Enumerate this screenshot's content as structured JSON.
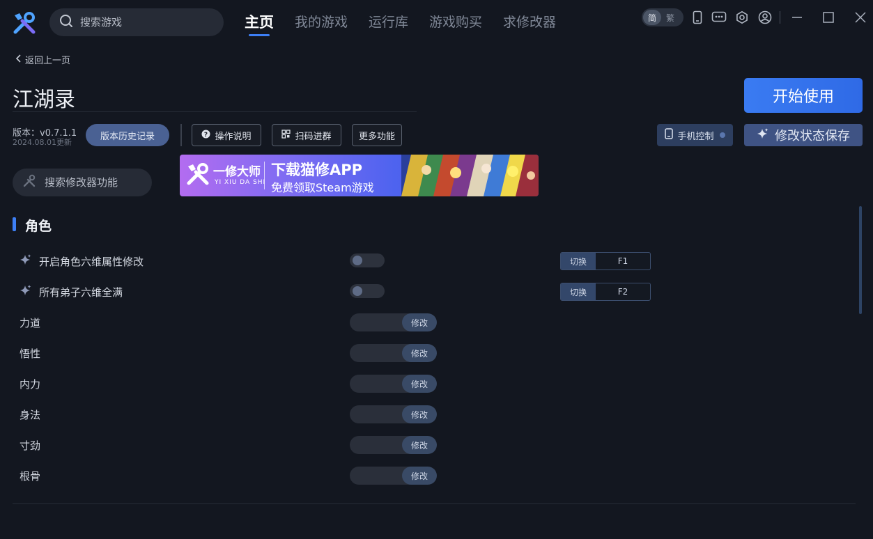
{
  "header": {
    "search_placeholder": "搜索游戏",
    "nav": [
      {
        "label": "主页",
        "active": true
      },
      {
        "label": "我的游戏",
        "active": false
      },
      {
        "label": "运行库",
        "active": false
      },
      {
        "label": "游戏购买",
        "active": false
      },
      {
        "label": "求修改器",
        "active": false
      }
    ],
    "lang": {
      "simplified": "简",
      "traditional": "繁",
      "selected": "简"
    },
    "icons": [
      "phone-icon",
      "message-icon",
      "settings-icon",
      "user-icon",
      "minimize-icon",
      "maximize-icon",
      "close-icon"
    ]
  },
  "back_label": "返回上一页",
  "game": {
    "title": "江湖录",
    "version": "版本：v0.7.1.1",
    "updated": "2024.08.01更新"
  },
  "buttons": {
    "start": "开始使用",
    "history": "版本历史记录",
    "guide": "操作说明",
    "qr": "扫码进群",
    "more": "更多功能",
    "phone": "手机控制",
    "save_state": "修改状态保存"
  },
  "mod_search_placeholder": "搜索修改器功能",
  "banner": {
    "brand": "一修大师",
    "brand_sub": "YI XIU DA SHI",
    "headline": "下载猫修APP",
    "subline": "免费领取Steam游戏"
  },
  "section": {
    "title": "角色",
    "toggles": [
      {
        "label": "开启角色六维属性修改",
        "hotkey_label": "切换",
        "hotkey": "F1",
        "on": false
      },
      {
        "label": "所有弟子六维全满",
        "hotkey_label": "切换",
        "hotkey": "F2",
        "on": false
      }
    ],
    "edits": [
      {
        "label": "力道",
        "button": "修改",
        "value": ""
      },
      {
        "label": "悟性",
        "button": "修改",
        "value": ""
      },
      {
        "label": "内力",
        "button": "修改",
        "value": ""
      },
      {
        "label": "身法",
        "button": "修改",
        "value": ""
      },
      {
        "label": "寸劲",
        "button": "修改",
        "value": ""
      },
      {
        "label": "根骨",
        "button": "修改",
        "value": ""
      }
    ]
  },
  "colors": {
    "background": "#131720",
    "accent": "#3d7ff5",
    "button_muted": "#4a6193"
  }
}
